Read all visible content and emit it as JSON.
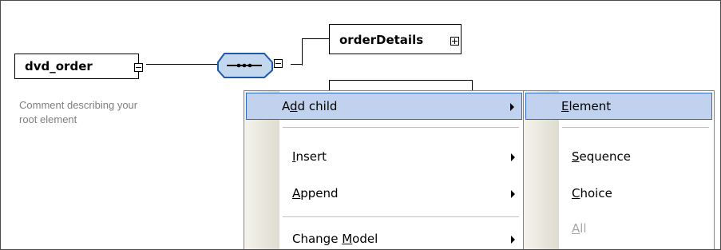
{
  "diagram": {
    "root_element": {
      "name": "dvd_order",
      "comment_line1": "Comment describing your",
      "comment_line2": "root element"
    },
    "sequence_node": {
      "icon": "sequence-compositor-icon"
    },
    "children": [
      {
        "name": "orderDetails"
      }
    ]
  },
  "context_menu": {
    "items": [
      {
        "label_pre": "A",
        "label_ul": "d",
        "label_post": "d child",
        "has_submenu": true,
        "selected": true
      },
      {
        "label_pre": "",
        "label_ul": "I",
        "label_post": "nsert",
        "has_submenu": true
      },
      {
        "label_pre": "",
        "label_ul": "A",
        "label_post": "ppend",
        "has_submenu": true
      },
      {
        "label_pre": "Change ",
        "label_ul": "M",
        "label_post": "odel",
        "has_submenu": true
      }
    ]
  },
  "submenu": {
    "items": [
      {
        "label_pre": "",
        "label_ul": "E",
        "label_post": "lement",
        "selected": true
      },
      {
        "label_pre": "",
        "label_ul": "S",
        "label_post": "equence"
      },
      {
        "label_pre": "",
        "label_ul": "C",
        "label_post": "hoice"
      },
      {
        "label_pre": "",
        "label_ul": "A",
        "label_post": "ll",
        "disabled": true
      }
    ]
  }
}
